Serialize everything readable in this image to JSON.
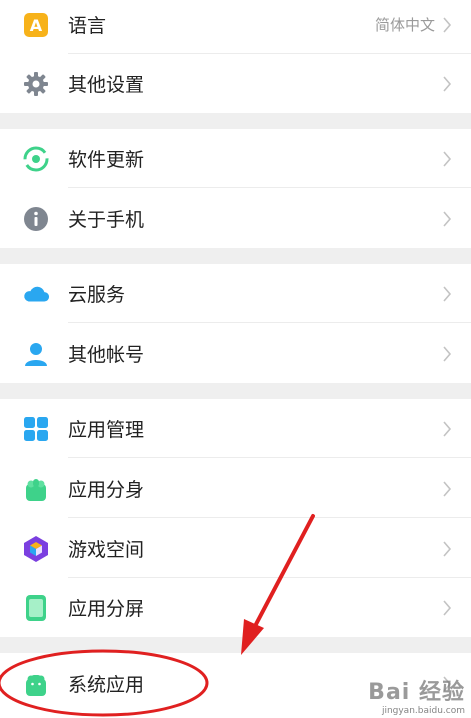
{
  "settings": {
    "groups": [
      {
        "items": [
          {
            "icon": "language-icon",
            "label": "语言",
            "value": "简体中文"
          },
          {
            "icon": "gear-icon",
            "label": "其他设置"
          }
        ]
      },
      {
        "items": [
          {
            "icon": "software-update-icon",
            "label": "软件更新"
          },
          {
            "icon": "info-icon",
            "label": "关于手机"
          }
        ]
      },
      {
        "items": [
          {
            "icon": "cloud-icon",
            "label": "云服务"
          },
          {
            "icon": "account-icon",
            "label": "其他帐号"
          }
        ]
      },
      {
        "items": [
          {
            "icon": "app-grid-icon",
            "label": "应用管理"
          },
          {
            "icon": "app-clone-icon",
            "label": "应用分身"
          },
          {
            "icon": "game-space-icon",
            "label": "游戏空间"
          },
          {
            "icon": "split-screen-icon",
            "label": "应用分屏"
          }
        ]
      },
      {
        "items": [
          {
            "icon": "system-apps-icon",
            "label": "系统应用"
          }
        ]
      }
    ]
  },
  "colors": {
    "annotation_red": "#e02020",
    "accent_orange": "#f7b21a",
    "accent_green": "#3ed28a",
    "accent_blue": "#2aa7f0"
  },
  "watermark": {
    "brand": "Bai 经验",
    "url": "jingyan.baidu.com"
  }
}
